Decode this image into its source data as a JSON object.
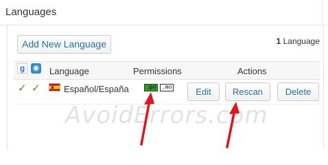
{
  "panel": {
    "title": "Languages"
  },
  "toolbar": {
    "add_label": "Add New Language",
    "count_number": "1",
    "count_label": "Language"
  },
  "table": {
    "headers": {
      "google_icon": "google-icon",
      "translate_icon": "translate-service-icon",
      "language": "Language",
      "permissions": "Permissions",
      "actions": "Actions"
    },
    "rows": [
      {
        "google_check": "✓",
        "service_check": "✓",
        "flag_icon": "spain-flag-icon",
        "language": "Español/España",
        "perm_po": ".po",
        "perm_mo": ".mo",
        "edit_label": "Edit",
        "rescan_label": "Rescan",
        "delete_label": "Delete"
      }
    ]
  },
  "watermark": "AvoidErrors.com",
  "colors": {
    "link_blue": "#21759b",
    "check_green": "#3a9a1e",
    "po_green": "#2f9c1f",
    "arrow_red": "#e3131b"
  }
}
